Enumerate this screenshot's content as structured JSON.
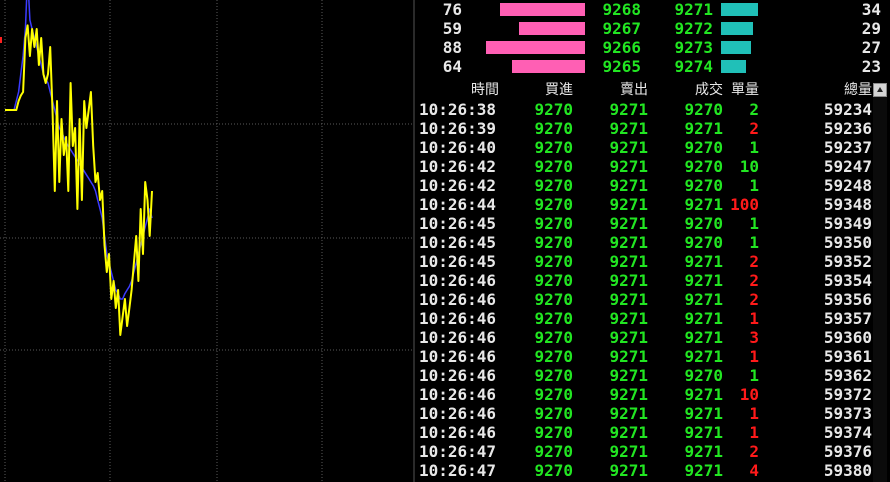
{
  "colors": {
    "background": "#000000",
    "grid": "#5a5a5a",
    "price_line": "#ffff00",
    "avg_line": "#3c3cff",
    "bid_bar": "#ff5fb4",
    "ask_bar": "#20c0b8",
    "up_text": "#22e622",
    "down_text": "#ff1a1a",
    "neutral_text": "#e8e8e8"
  },
  "depth": [
    {
      "bid_qty": "76",
      "bid_bar": 0.68,
      "bid_price": "9268",
      "ask_price": "9271",
      "ask_bar": 0.34,
      "ask_qty": "34"
    },
    {
      "bid_qty": "59",
      "bid_bar": 0.53,
      "bid_price": "9267",
      "ask_price": "9272",
      "ask_bar": 0.29,
      "ask_qty": "29"
    },
    {
      "bid_qty": "88",
      "bid_bar": 0.79,
      "bid_price": "9266",
      "ask_price": "9273",
      "ask_bar": 0.27,
      "ask_qty": "27"
    },
    {
      "bid_qty": "64",
      "bid_bar": 0.58,
      "bid_price": "9265",
      "ask_price": "9274",
      "ask_bar": 0.23,
      "ask_qty": "23"
    }
  ],
  "ticks": {
    "headers": [
      "時間",
      "買進",
      "賣出",
      "成交",
      "單量",
      "總量"
    ],
    "rows": [
      {
        "time": "10:26:38",
        "bid": "9270",
        "ask": "9271",
        "deal": "9270",
        "vol": "2",
        "vol_color": "green",
        "total": "59234"
      },
      {
        "time": "10:26:39",
        "bid": "9270",
        "ask": "9271",
        "deal": "9271",
        "vol": "2",
        "vol_color": "red",
        "total": "59236"
      },
      {
        "time": "10:26:40",
        "bid": "9270",
        "ask": "9271",
        "deal": "9270",
        "vol": "1",
        "vol_color": "green",
        "total": "59237"
      },
      {
        "time": "10:26:42",
        "bid": "9270",
        "ask": "9271",
        "deal": "9270",
        "vol": "10",
        "vol_color": "green",
        "total": "59247"
      },
      {
        "time": "10:26:42",
        "bid": "9270",
        "ask": "9271",
        "deal": "9270",
        "vol": "1",
        "vol_color": "green",
        "total": "59248"
      },
      {
        "time": "10:26:44",
        "bid": "9270",
        "ask": "9271",
        "deal": "9271",
        "vol": "100",
        "vol_color": "red",
        "total": "59348"
      },
      {
        "time": "10:26:45",
        "bid": "9270",
        "ask": "9271",
        "deal": "9270",
        "vol": "1",
        "vol_color": "green",
        "total": "59349"
      },
      {
        "time": "10:26:45",
        "bid": "9270",
        "ask": "9271",
        "deal": "9270",
        "vol": "1",
        "vol_color": "green",
        "total": "59350"
      },
      {
        "time": "10:26:45",
        "bid": "9270",
        "ask": "9271",
        "deal": "9271",
        "vol": "2",
        "vol_color": "red",
        "total": "59352"
      },
      {
        "time": "10:26:46",
        "bid": "9270",
        "ask": "9271",
        "deal": "9271",
        "vol": "2",
        "vol_color": "red",
        "total": "59354"
      },
      {
        "time": "10:26:46",
        "bid": "9270",
        "ask": "9271",
        "deal": "9271",
        "vol": "2",
        "vol_color": "red",
        "total": "59356"
      },
      {
        "time": "10:26:46",
        "bid": "9270",
        "ask": "9271",
        "deal": "9271",
        "vol": "1",
        "vol_color": "red",
        "total": "59357"
      },
      {
        "time": "10:26:46",
        "bid": "9270",
        "ask": "9271",
        "deal": "9271",
        "vol": "3",
        "vol_color": "red",
        "total": "59360"
      },
      {
        "time": "10:26:46",
        "bid": "9270",
        "ask": "9271",
        "deal": "9271",
        "vol": "1",
        "vol_color": "red",
        "total": "59361"
      },
      {
        "time": "10:26:46",
        "bid": "9270",
        "ask": "9271",
        "deal": "9270",
        "vol": "1",
        "vol_color": "green",
        "total": "59362"
      },
      {
        "time": "10:26:46",
        "bid": "9270",
        "ask": "9271",
        "deal": "9271",
        "vol": "10",
        "vol_color": "red",
        "total": "59372"
      },
      {
        "time": "10:26:46",
        "bid": "9270",
        "ask": "9271",
        "deal": "9271",
        "vol": "1",
        "vol_color": "red",
        "total": "59373"
      },
      {
        "time": "10:26:46",
        "bid": "9270",
        "ask": "9271",
        "deal": "9271",
        "vol": "1",
        "vol_color": "red",
        "total": "59374"
      },
      {
        "time": "10:26:47",
        "bid": "9270",
        "ask": "9271",
        "deal": "9271",
        "vol": "2",
        "vol_color": "red",
        "total": "59376"
      },
      {
        "time": "10:26:47",
        "bid": "9270",
        "ask": "9271",
        "deal": "9271",
        "vol": "4",
        "vol_color": "red",
        "total": "59380"
      }
    ]
  },
  "chart_data": {
    "type": "line",
    "title": "",
    "xlabel": "",
    "ylabel": "",
    "grid": true,
    "series": [
      {
        "color": "#ffff00",
        "values": [
          0.5,
          0.5,
          0.5,
          0.5,
          0.5,
          0.5,
          0.45,
          0.42,
          0.4,
          0.1,
          0.03,
          0.2,
          0.05,
          0.15,
          0.05,
          0.25,
          0.1,
          0.3,
          0.35,
          0.3,
          0.15,
          0.5,
          0.95,
          0.45,
          0.9,
          0.55,
          0.75,
          0.65,
          0.95,
          0.35,
          0.7,
          0.6,
          1.05,
          0.55,
          1.0,
          0.45,
          0.6,
          0.5,
          0.4,
          0.7,
          0.9,
          0.85,
          1.0,
          0.95,
          1.25,
          1.4,
          1.3,
          1.55,
          1.45,
          1.6,
          1.5,
          1.75,
          1.65,
          1.55,
          1.7,
          1.6,
          1.5,
          1.35,
          1.2,
          1.45,
          1.05,
          1.3,
          0.9,
          1.0,
          1.2,
          0.95
        ]
      },
      {
        "color": "#3c3cff",
        "values": [
          0.5,
          0.5,
          0.5,
          0.5,
          0.5,
          0.45,
          0.4,
          0.3,
          0.2,
          0.05,
          -0.25,
          0.0,
          0.05,
          0.1,
          0.15,
          0.2,
          0.25,
          0.3,
          0.33,
          0.35,
          0.4,
          0.45,
          0.5,
          0.55,
          0.6,
          0.62,
          0.65,
          0.68,
          0.7,
          0.72,
          0.74,
          0.76,
          0.78,
          0.8,
          0.82,
          0.84,
          0.86,
          0.88,
          0.9,
          0.92,
          0.95,
          1.0,
          1.05,
          1.1,
          1.2,
          1.3,
          1.35,
          1.4,
          1.45,
          1.5,
          1.52,
          1.55,
          1.55,
          1.52,
          1.5,
          1.48,
          1.45,
          1.4,
          1.35,
          1.3,
          1.25,
          1.2,
          1.15,
          1.1,
          1.05,
          1.1
        ]
      }
    ]
  }
}
